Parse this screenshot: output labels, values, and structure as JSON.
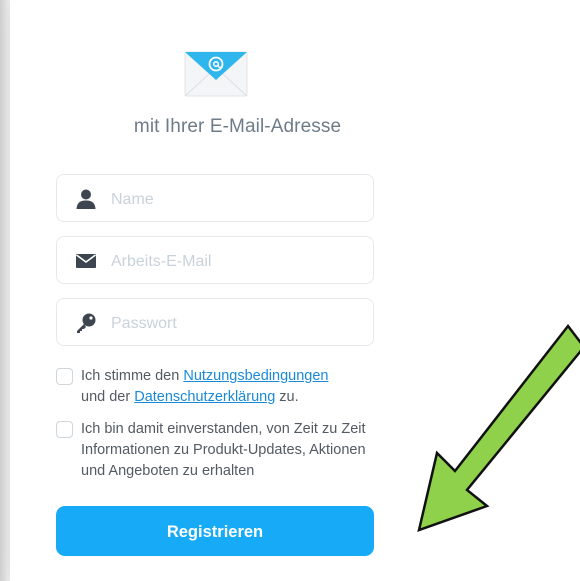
{
  "header": {
    "icon": "email-envelope-icon",
    "subtitle": "mit Ihrer E-Mail-Adresse"
  },
  "form": {
    "name_placeholder": "Name",
    "email_placeholder": "Arbeits-E-Mail",
    "password_placeholder": "Passwort",
    "icons": [
      "user-icon",
      "mail-icon",
      "key-icon"
    ]
  },
  "consent": {
    "terms_prefix": "Ich stimme den ",
    "terms_link": "Nutzungsbedingungen",
    "terms_middle": "und der ",
    "privacy_link": "Datenschutzerklärung",
    "terms_suffix": " zu.",
    "marketing_text": "Ich bin damit einverstanden, von Zeit zu Zeit Informationen zu Produkt-Updates, Aktionen und Angeboten zu erhalten"
  },
  "actions": {
    "register_label": "Registrieren"
  },
  "colors": {
    "accent": "#17aaf6",
    "link": "#1a8ad8",
    "arrow_fill": "#8fd14a",
    "envelope": "#2fb6ec"
  }
}
